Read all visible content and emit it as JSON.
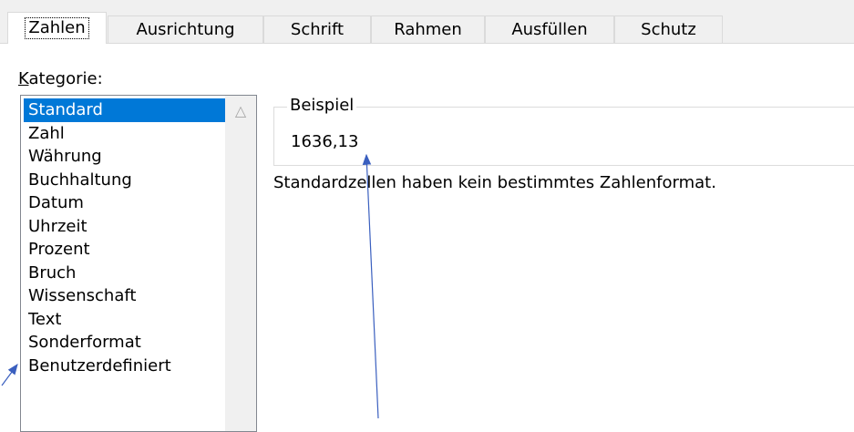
{
  "tabs": [
    {
      "label": "Zahlen",
      "active": true
    },
    {
      "label": "Ausrichtung"
    },
    {
      "label": "Schrift"
    },
    {
      "label": "Rahmen"
    },
    {
      "label": "Ausfüllen"
    },
    {
      "label": "Schutz"
    }
  ],
  "kategorie": {
    "label_accesskey": "K",
    "label_rest": "ategorie:",
    "items": [
      "Standard",
      "Zahl",
      "Währung",
      "Buchhaltung",
      "Datum",
      "Uhrzeit",
      "Prozent",
      "Bruch",
      "Wissenschaft",
      "Text",
      "Sonderformat",
      "Benutzerdefiniert"
    ],
    "selected": "Standard"
  },
  "beispiel": {
    "legend": "Beispiel",
    "value": "1636,13"
  },
  "description": "Standardzellen haben kein bestimmtes Zahlenformat.",
  "colors": {
    "selection": "#0078d7",
    "annotation_arrow": "#3a5fbf"
  }
}
